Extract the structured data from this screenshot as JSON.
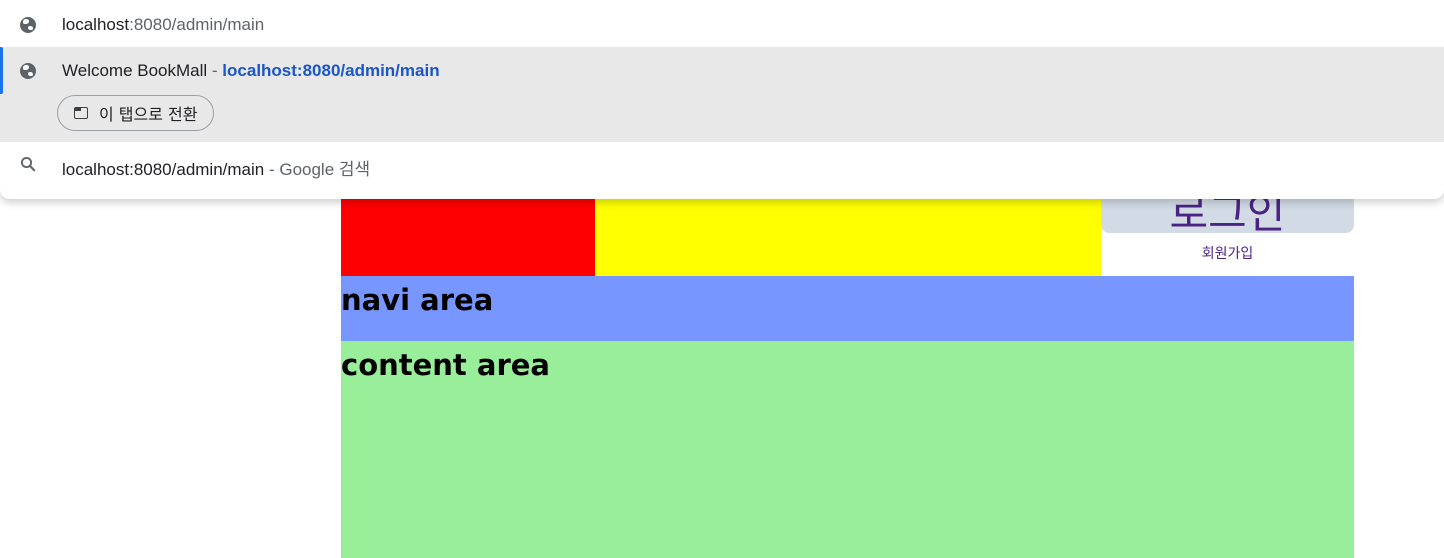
{
  "page": {
    "logo_text": "로그인",
    "signup_label": "회원가입",
    "navi_title": "navi area",
    "content_title": "content area",
    "colors": {
      "header_left": "#ff0000",
      "header_middle": "#ffff00",
      "navi": "#7896ff",
      "content": "#99ef99",
      "login_bg": "#d2dbe5",
      "login_text": "#4b2384"
    }
  },
  "omnibox": {
    "input": {
      "icon": "globe-icon",
      "host": "localhost",
      "rest": ":8080/admin/main"
    },
    "selected": {
      "icon": "globe-icon",
      "title": "Welcome BookMall",
      "separator": " - ",
      "url": "localhost:8080/admin/main",
      "switch_tab_label": "이 탭으로 전환",
      "switch_tab_icon": "tab-switch-icon"
    },
    "search": {
      "icon": "search-icon",
      "query": "localhost:8080/admin/main",
      "separator": " - ",
      "engine_label": "Google 검색"
    }
  }
}
